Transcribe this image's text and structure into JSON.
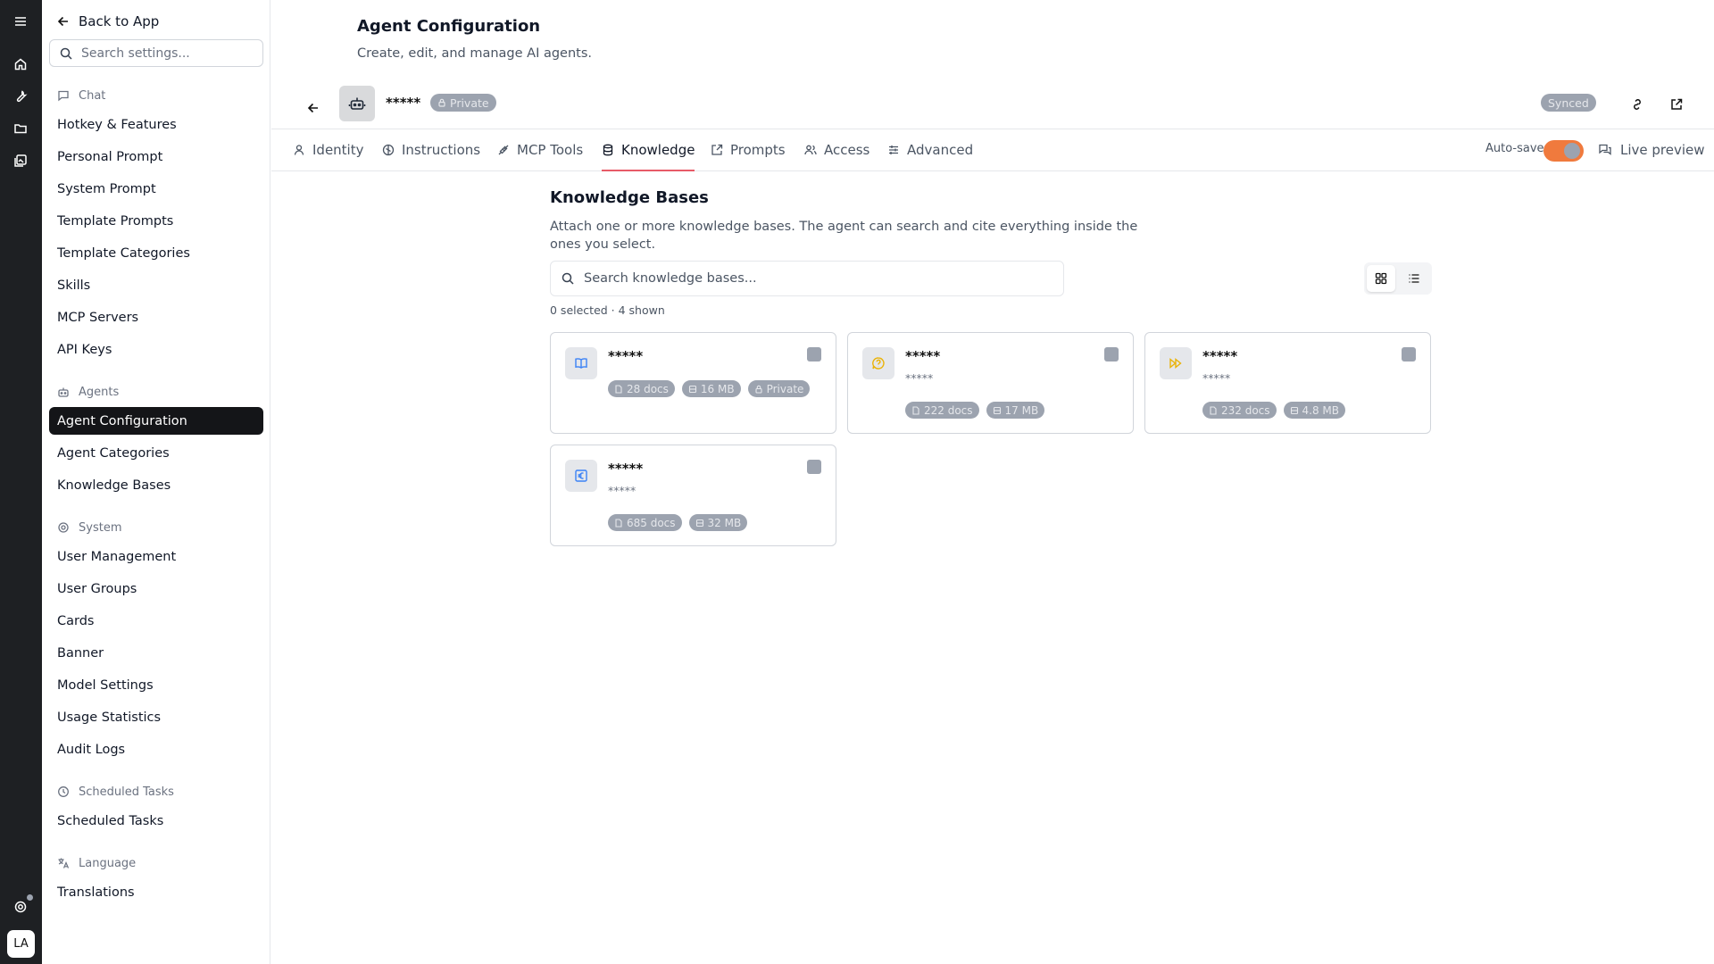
{
  "sidebar": {
    "back_label": "Back to App",
    "search_placeholder": "Search settings...",
    "sections": {
      "chat": "Chat",
      "agents": "Agents",
      "system": "System",
      "scheduled": "Scheduled Tasks",
      "language": "Language"
    },
    "chat_items": [
      "Hotkey & Features",
      "Personal Prompt",
      "System Prompt",
      "Template Prompts",
      "Template Categories",
      "Skills",
      "MCP Servers",
      "API Keys"
    ],
    "agent_items": [
      "Agent Configuration",
      "Agent Categories",
      "Knowledge Bases"
    ],
    "system_items": [
      "User Management",
      "User Groups",
      "Cards",
      "Banner",
      "Model Settings",
      "Usage Statistics",
      "Audit Logs"
    ],
    "scheduled_items": [
      "Scheduled Tasks"
    ],
    "language_items": [
      "Translations"
    ],
    "active_item": "Agent Configuration"
  },
  "rail": {
    "avatar_initials": "LA"
  },
  "header": {
    "title": "Agent Configuration",
    "subtitle": "Create, edit, and manage AI agents."
  },
  "agent": {
    "name": "*****",
    "visibility": "Private",
    "sync_status": "Synced"
  },
  "tabs": [
    {
      "label": "Identity",
      "icon": "user-icon"
    },
    {
      "label": "Instructions",
      "icon": "brain-icon"
    },
    {
      "label": "MCP Tools",
      "icon": "plug-icon"
    },
    {
      "label": "Knowledge",
      "icon": "database-icon"
    },
    {
      "label": "Prompts",
      "icon": "prompt-icon"
    },
    {
      "label": "Access",
      "icon": "users-icon"
    },
    {
      "label": "Advanced",
      "icon": "sliders-icon"
    }
  ],
  "active_tab": "Knowledge",
  "toolbar": {
    "autosave_label": "Auto-save",
    "autosave_on": true,
    "preview_label": "Live preview"
  },
  "knowledge": {
    "title": "Knowledge Bases",
    "description": "Attach one or more knowledge bases. The agent can search and cite everything inside the ones you select.",
    "search_placeholder": "Search knowledge bases...",
    "counter": "0 selected · 4 shown",
    "view_mode": "grid",
    "cards": [
      {
        "name": "*****",
        "description": "",
        "docs": "28 docs",
        "size": "16 MB",
        "badge": "Private",
        "icon": "book-icon",
        "icon_color": "#3b82f6"
      },
      {
        "name": "*****",
        "description": "*****",
        "docs": "222 docs",
        "size": "17 MB",
        "badge": "",
        "icon": "chat-question-icon",
        "icon_color": "#eab308"
      },
      {
        "name": "*****",
        "description": "*****",
        "docs": "232 docs",
        "size": "4.8 MB",
        "badge": "",
        "icon": "fast-forward-icon",
        "icon_color": "#eab308"
      },
      {
        "name": "*****",
        "description": "*****",
        "docs": "685 docs",
        "size": "32 MB",
        "badge": "",
        "icon": "euro-icon",
        "icon_color": "#3b82f6"
      }
    ]
  },
  "colors": {
    "accent": "#e75b67",
    "toggle_on": "#f07a3d",
    "rail_bg": "#1e2023",
    "active_item_bg": "#141518",
    "pill_bg": "#9ca3af"
  }
}
